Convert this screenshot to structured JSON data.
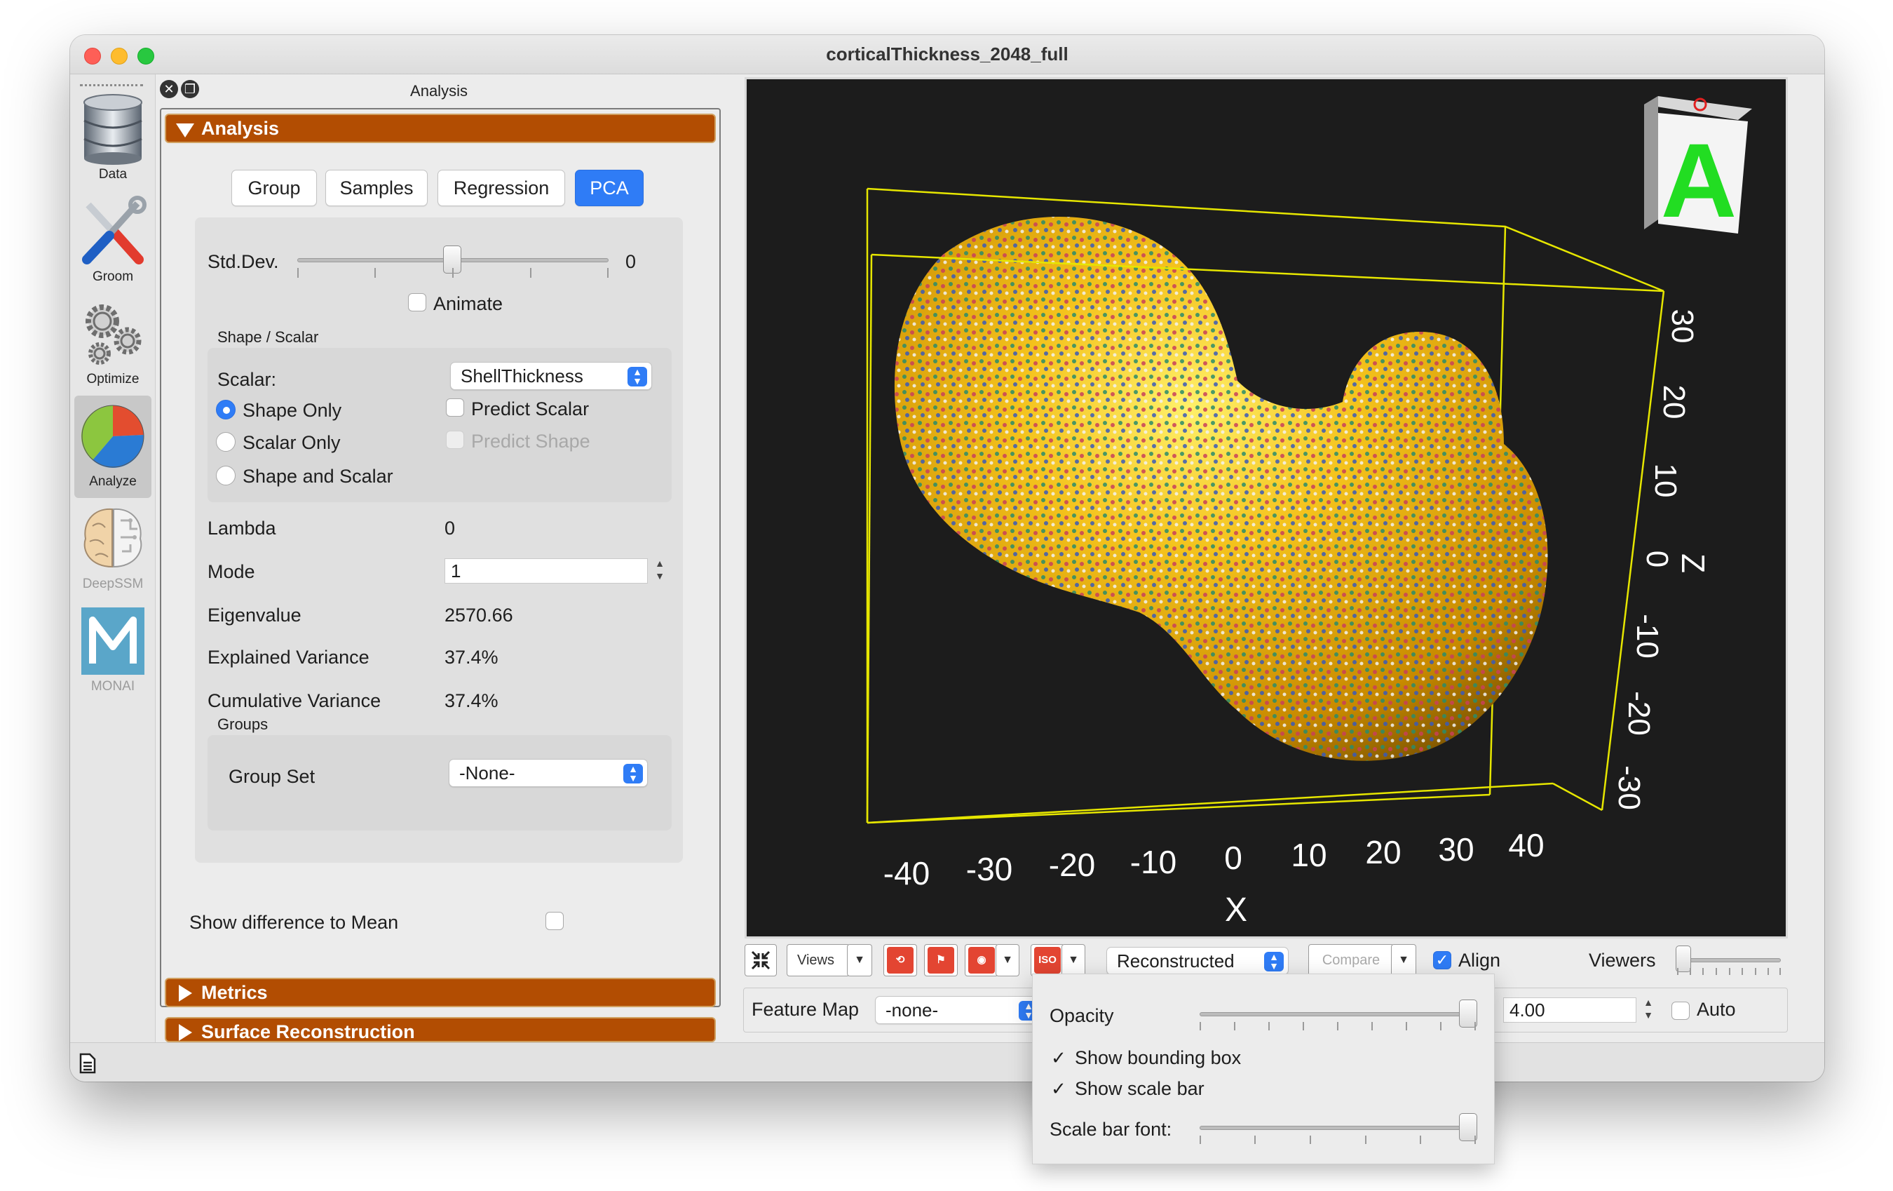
{
  "window": {
    "title": "corticalThickness_2048_full"
  },
  "toolbar": {
    "items": [
      {
        "label": "Data",
        "icon": "database-icon"
      },
      {
        "label": "Groom",
        "icon": "tools-icon"
      },
      {
        "label": "Optimize",
        "icon": "gears-icon"
      },
      {
        "label": "Analyze",
        "icon": "pie-chart-icon",
        "active": true
      },
      {
        "label": "DeepSSM",
        "icon": "brain-icon",
        "disabled": true
      },
      {
        "label": "MONAI",
        "icon": "monai-icon",
        "disabled": true
      }
    ]
  },
  "panel": {
    "title": "Analysis",
    "section_analysis": "Analysis",
    "section_metrics": "Metrics",
    "section_surface": "Surface Reconstruction",
    "tabs": [
      {
        "label": "Group"
      },
      {
        "label": "Samples"
      },
      {
        "label": "Regression"
      },
      {
        "label": "PCA",
        "selected": true
      }
    ],
    "std_dev_label": "Std.Dev.",
    "std_dev_value": "0",
    "std_dev_position": 0.5,
    "animate_label": "Animate",
    "shape_scalar_title": "Shape / Scalar",
    "scalar_label": "Scalar:",
    "scalar_value": "ShellThickness",
    "radio_shape_only": "Shape Only",
    "radio_scalar_only": "Scalar Only",
    "radio_shape_and_scalar": "Shape and Scalar",
    "predict_scalar": "Predict Scalar",
    "predict_shape": "Predict Shape",
    "lambda_label": "Lambda",
    "lambda_value": "0",
    "mode_label": "Mode",
    "mode_value": "1",
    "eigenvalue_label": "Eigenvalue",
    "eigenvalue_value": "2570.66",
    "explained_label": "Explained Variance",
    "explained_value": "37.4%",
    "cumulative_label": "Cumulative Variance",
    "cumulative_value": "37.4%",
    "groups_title": "Groups",
    "group_set_label": "Group Set",
    "group_set_value": "-None-",
    "show_diff_label": "Show difference to Mean"
  },
  "viewer": {
    "x_ticks": [
      "-40",
      "-30",
      "-20",
      "-10",
      "0",
      "10",
      "20",
      "30",
      "40"
    ],
    "x_label": "X",
    "z_ticks": [
      "30",
      "20",
      "10",
      "0",
      "-10",
      "-20",
      "-30"
    ],
    "z_label": "Z",
    "orientation_letter": "A",
    "colors": {
      "background": "#1c1c1c",
      "box": "#e6e600",
      "surface": "#e0a800",
      "axis_text": "#ffffff"
    }
  },
  "controls": {
    "views_label": "Views",
    "iso_label": "ISO",
    "display_mode": "Reconstructed",
    "compare_label": "Compare",
    "align_label": "Align",
    "viewers_label": "Viewers",
    "feature_map_label": "Feature Map",
    "feature_map_value": "-none-",
    "range_value": "4.00",
    "auto_label": "Auto"
  },
  "popup": {
    "opacity_label": "Opacity",
    "opacity_value": 1.0,
    "show_bbox": "Show bounding box",
    "show_scale": "Show scale bar",
    "scale_font_label": "Scale bar font:",
    "scale_font_value": 1.0
  },
  "accent": "#2f7cf6",
  "section_color": "#b24d02"
}
